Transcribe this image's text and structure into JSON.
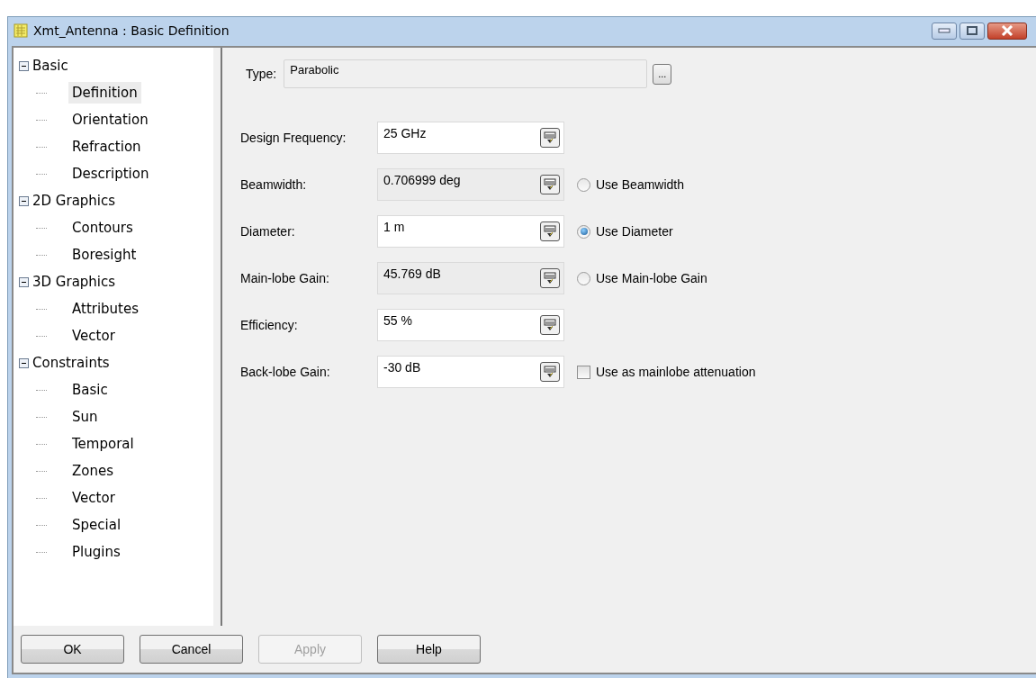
{
  "window": {
    "title": "Xmt_Antenna : Basic Definition"
  },
  "tree": [
    {
      "label": "Basic",
      "expanded": true,
      "children": [
        {
          "label": "Definition",
          "selected": true
        },
        {
          "label": "Orientation",
          "selected": false
        },
        {
          "label": "Refraction",
          "selected": false
        },
        {
          "label": "Description",
          "selected": false
        }
      ]
    },
    {
      "label": "2D Graphics",
      "expanded": true,
      "children": [
        {
          "label": "Contours",
          "selected": false
        },
        {
          "label": "Boresight",
          "selected": false
        }
      ]
    },
    {
      "label": "3D Graphics",
      "expanded": true,
      "children": [
        {
          "label": "Attributes",
          "selected": false
        },
        {
          "label": "Vector",
          "selected": false
        }
      ]
    },
    {
      "label": "Constraints",
      "expanded": true,
      "children": [
        {
          "label": "Basic",
          "selected": false
        },
        {
          "label": "Sun",
          "selected": false
        },
        {
          "label": "Temporal",
          "selected": false
        },
        {
          "label": "Zones",
          "selected": false
        },
        {
          "label": "Vector",
          "selected": false
        },
        {
          "label": "Special",
          "selected": false
        },
        {
          "label": "Plugins",
          "selected": false
        }
      ]
    }
  ],
  "type": {
    "label": "Type:",
    "value": "Parabolic",
    "browse": "..."
  },
  "fields": [
    {
      "label": "Design Frequency:",
      "value": "25 GHz",
      "readonly": false
    },
    {
      "label": "Beamwidth:",
      "value": "0.706999 deg",
      "readonly": true,
      "option": {
        "kind": "radio",
        "label": "Use Beamwidth",
        "selected": false
      }
    },
    {
      "label": "Diameter:",
      "value": "1 m",
      "readonly": false,
      "option": {
        "kind": "radio",
        "label": "Use Diameter",
        "selected": true
      }
    },
    {
      "label": "Main-lobe Gain:",
      "value": "45.769 dB",
      "readonly": true,
      "option": {
        "kind": "radio",
        "label": "Use Main-lobe Gain",
        "selected": false
      }
    },
    {
      "label": "Efficiency:",
      "value": "55 %",
      "readonly": false
    },
    {
      "label": "Back-lobe Gain:",
      "value": "-30 dB",
      "readonly": false,
      "option": {
        "kind": "checkbox",
        "label": "Use as mainlobe attenuation",
        "checked": false
      }
    }
  ],
  "buttons": [
    {
      "label": "OK",
      "disabled": false
    },
    {
      "label": "Cancel",
      "disabled": false
    },
    {
      "label": "Apply",
      "disabled": true
    },
    {
      "label": "Help",
      "disabled": false
    }
  ]
}
